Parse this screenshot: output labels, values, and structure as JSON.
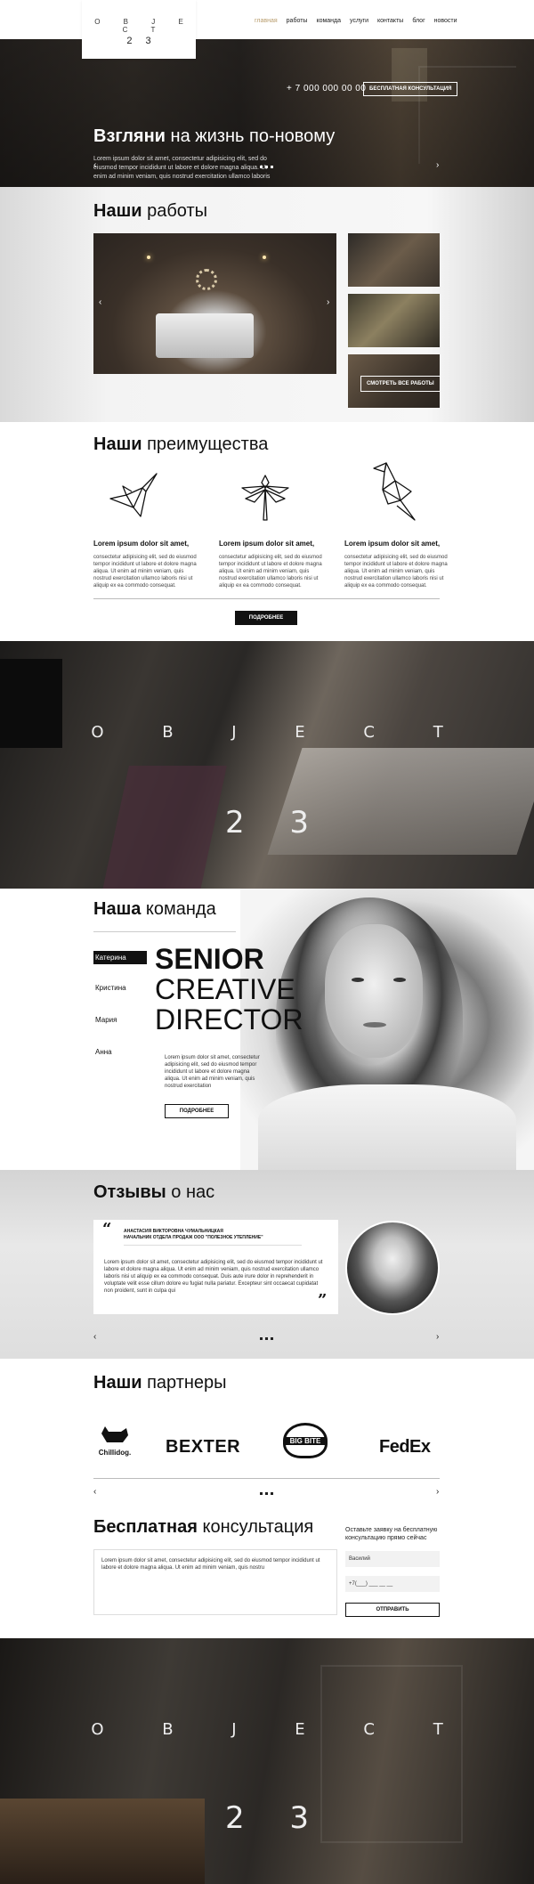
{
  "header": {
    "logo_word": "O B J E C T",
    "logo_number": "2 3",
    "nav": [
      "главная",
      "работы",
      "команда",
      "услуги",
      "контакты",
      "блог",
      "новости"
    ]
  },
  "hero": {
    "phone": "+ 7 000 000 00 00",
    "consult_button": "БЕСПЛАТНАЯ КОНСУЛЬТАЦИЯ",
    "title_bold": "Взгляни",
    "title_rest": " на жизнь по-новому",
    "text": "Lorem ipsum dolor sit amet, consectetur adipisicing elit, sed do eiusmod tempor incididunt ut labore et dolore magna aliqua. Ut enim ad minim veniam, quis nostrud exercitation ullamco laboris"
  },
  "works": {
    "title_bold": "Наши",
    "title_rest": " работы",
    "see_all": "СМОТРЕТЬ ВСЕ РАБОТЫ"
  },
  "advantages": {
    "title_bold": "Наши",
    "title_rest": " преимущества",
    "items": [
      {
        "icon": "origami-bird-icon",
        "title": "Lorem ipsum dolor sit amet,",
        "text": "consectetur adipisicing elit, sed do eiusmod tempor incididunt ut labore et dolore magna aliqua. Ut enim ad minim veniam, quis nostrud exercitation ullamco laboris nisi ut aliquip ex ea commodo consequat."
      },
      {
        "icon": "origami-dragonfly-icon",
        "title": "Lorem ipsum dolor sit amet,",
        "text": "consectetur adipisicing elit, sed do eiusmod tempor incididunt ut labore et dolore magna aliqua. Ut enim ad minim veniam, quis nostrud exercitation ullamco laboris nisi ut aliquip ex ea commodo consequat."
      },
      {
        "icon": "origami-parrot-icon",
        "title": "Lorem ipsum dolor sit amet,",
        "text": "consectetur adipisicing elit, sed do eiusmod tempor incididunt ut labore et dolore magna aliqua. Ut enim ad minim veniam, quis nostrud exercitation ullamco laboris nisi ut aliquip ex ea commodo consequat."
      }
    ],
    "more_button": "ПОДРОБНЕЕ"
  },
  "banner": {
    "word": "O B J E C T",
    "number": "2 3"
  },
  "team": {
    "title_bold": "Наша",
    "title_rest": " команда",
    "members": [
      "Катерина",
      "Кристина",
      "Мария",
      "Анна"
    ],
    "role_line1": "SENIOR",
    "role_line2": "CREATIVE",
    "role_line3": "DIRECTOR",
    "text": "Lorem ipsum dolor sit amet, consectetur adipisicing elit, sed do eiusmod tempor incididunt ut labore et dolore magna aliqua. Ut enim ad minim veniam, quis nostrud exercitation",
    "more_button": "ПОДРОБНЕЕ"
  },
  "reviews": {
    "title_bold": "Отзывы",
    "title_rest": " о нас",
    "name": "АНАСТАСИЯ ВИКТОРОВНА ЧУМАЛЬНИЦКАЯ",
    "position": "НАЧАЛЬНИК ОТДЕЛА ПРОДАЖ ООО \"ПОЛЕЗНОЕ УТЕПЛЕНИЕ\"",
    "quote_open": "“",
    "quote_close": "”",
    "text": "Lorem ipsum dolor sit amet, consectetur adipisicing elit, sed do eiusmod tempor incididunt ut labore et dolore magna aliqua. Ut enim ad minim veniam, quis nostrud exercitation ullamco laboris nisi ut aliquip ex ea commodo consequat. Duis aute irure dolor in reprehenderit in voluptate velit esse cillum dolore eu fugiat nulla pariatur. Excepteur sint occaecat cupidatat non proident, sunt in culpa qui"
  },
  "partners": {
    "title_bold": "Наши",
    "title_rest": " партнеры",
    "logos": [
      "Chillidog.",
      "BEXTER",
      "BIG BITE",
      "FedEx"
    ]
  },
  "consult": {
    "title_bold": "Бесплатная",
    "title_rest": " консультация",
    "text": "Lorem ipsum dolor sit amet, consectetur adipisicing elit, sed do eiusmod tempor incididunt ut labore et dolore magna aliqua. Ut enim ad minim veniam, quis nostru",
    "label": "Оставьте заявку на бесплатную консультацию прямо сейчас",
    "name_placeholder": "Василий",
    "phone_placeholder": "+7(___) ___ __ __",
    "send_button": "ОТПРАВИТЬ"
  },
  "arrows": {
    "left": "‹",
    "right": "›"
  },
  "colors": {
    "accent": "#b89c6c",
    "dark": "#111111"
  }
}
